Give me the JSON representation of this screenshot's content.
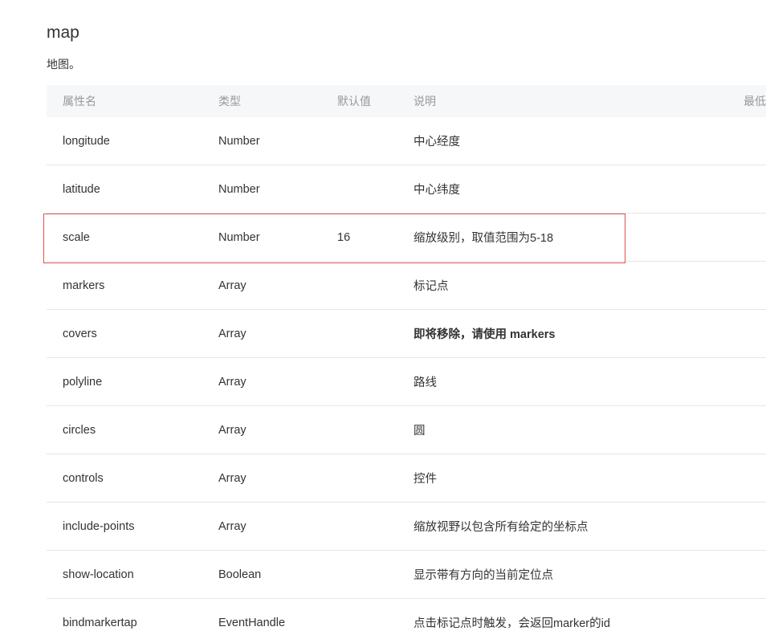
{
  "doc": {
    "title": "map",
    "description": "地图。"
  },
  "table": {
    "headers": {
      "name": "属性名",
      "type": "类型",
      "default": "默认值",
      "desc": "说明",
      "version": "最低"
    },
    "rows": [
      {
        "name": "longitude",
        "type": "Number",
        "default": "",
        "desc": "中心经度"
      },
      {
        "name": "latitude",
        "type": "Number",
        "default": "",
        "desc": "中心纬度"
      },
      {
        "name": "scale",
        "type": "Number",
        "default": "16",
        "desc": "缩放级别，取值范围为5-18"
      },
      {
        "name": "markers",
        "type": "Array",
        "default": "",
        "desc": "标记点"
      },
      {
        "name": "covers",
        "type": "Array",
        "default": "",
        "desc": "即将移除，请使用 markers"
      },
      {
        "name": "polyline",
        "type": "Array",
        "default": "",
        "desc": "路线"
      },
      {
        "name": "circles",
        "type": "Array",
        "default": "",
        "desc": "圆"
      },
      {
        "name": "controls",
        "type": "Array",
        "default": "",
        "desc": "控件"
      },
      {
        "name": "include-points",
        "type": "Array",
        "default": "",
        "desc": "缩放视野以包含所有给定的坐标点"
      },
      {
        "name": "show-location",
        "type": "Boolean",
        "default": "",
        "desc": "显示带有方向的当前定位点"
      },
      {
        "name": "bindmarkertap",
        "type": "EventHandle",
        "default": "",
        "desc": "点击标记点时触发，会返回marker的id"
      }
    ]
  },
  "colors": {
    "highlight": "#e05252",
    "header_bg": "#f6f7f9"
  }
}
